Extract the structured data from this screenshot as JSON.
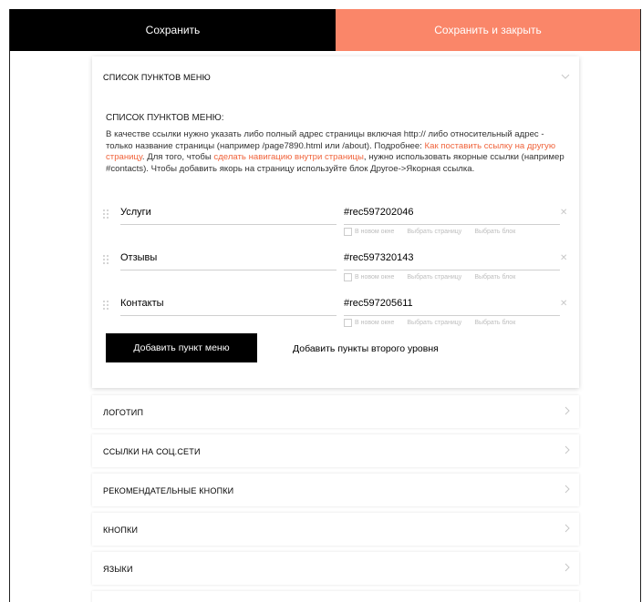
{
  "toolbar": {
    "save_label": "Сохранить",
    "save_close_label": "Сохранить и закрыть"
  },
  "menu_section": {
    "header": "СПИСОК ПУНКТОВ МЕНЮ",
    "field_label": "СПИСОК ПУНКТОВ МЕНЮ:",
    "desc_1": "В качестве ссылки нужно указать либо полный адрес страницы включая http:// либо относительный адрес - только название страницы (например /page7890.html или /about). Подробнее: ",
    "desc_link_1": "Как поставить ссылку на другую страницу",
    "desc_2": ". Для того, чтобы ",
    "desc_link_2": "сделать навигацию внутри страницы",
    "desc_3": ", нужно использовать якорные ссылки (например #contacts). Чтобы добавить якорь на страницу используйте блок Другое->Якорная ссылка.",
    "items": [
      {
        "title": "Услуги",
        "link": "#rec597202046",
        "opt_new_window": "В новом окне",
        "opt_select_page": "Выбрать страницу",
        "opt_select_block": "Выбрать блок"
      },
      {
        "title": "Отзывы",
        "link": "#rec597320143",
        "opt_new_window": "В новом окне",
        "opt_select_page": "Выбрать страницу",
        "opt_select_block": "Выбрать блок"
      },
      {
        "title": "Контакты",
        "link": "#rec597205611",
        "opt_new_window": "В новом окне",
        "opt_select_page": "Выбрать страницу",
        "opt_select_block": "Выбрать блок"
      }
    ],
    "add_item_label": "Добавить пункт меню",
    "add_second_level_label": "Добавить пункты второго уровня"
  },
  "sections": [
    {
      "label": "ЛОГОТИП"
    },
    {
      "label": "ССЫЛКИ НА СОЦ.СЕТИ"
    },
    {
      "label": "РЕКОМЕНДАТЕЛЬНЫЕ КНОПКИ"
    },
    {
      "label": "КНОПКИ"
    },
    {
      "label": "ЯЗЫКИ"
    }
  ],
  "colors": {
    "accent": "#fa8669",
    "link": "#f0643c",
    "dark": "#000000"
  },
  "icons": {
    "collapse": "chevron-down-icon",
    "expand": "chevron-right-icon",
    "remove": "close-icon",
    "drag": "drag-handle-icon"
  }
}
